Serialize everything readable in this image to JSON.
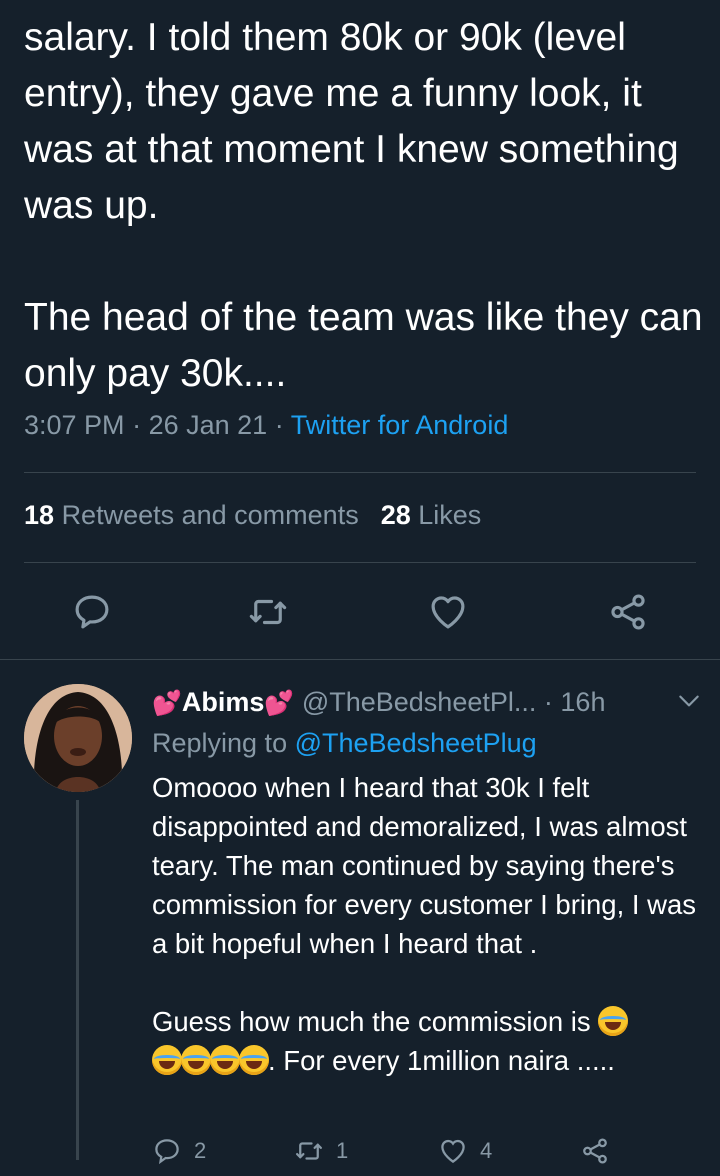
{
  "tweet": {
    "paragraph1": "salary. I told them 80k or 90k (level entry), they  gave me a funny look, it was at that moment I knew something was up.",
    "paragraph2": "The head of the team was like they can only pay 30k....",
    "time": "3:07 PM",
    "date": "26 Jan 21",
    "separator": "·",
    "source": "Twitter for Android"
  },
  "stats": {
    "retweets_count": "18",
    "retweets_label": "Retweets and comments",
    "likes_count": "28",
    "likes_label": "Likes"
  },
  "actions": {
    "icons": [
      "reply-icon",
      "retweet-icon",
      "like-icon",
      "share-icon"
    ]
  },
  "reply": {
    "display_name": "Abims",
    "name_emoji": "heart-emoji",
    "handle": "@TheBedsheetPl...",
    "separator": "·",
    "age": "16h",
    "replying_prefix": "Replying to",
    "replying_to": "@TheBedsheetPlug",
    "paragraph1": "Omoooo when I heard that 30k I felt disappointed and demoralized, I was almost teary. The man continued by saying there's commission for every customer I bring, I was a bit hopeful when I heard that .",
    "paragraph2_start": "Guess how much the commission is",
    "paragraph2_end": ". For every 1million naira .....",
    "emoji": "face-with-tears-of-joy",
    "counts": {
      "replies": "2",
      "retweets": "1",
      "likes": "4"
    }
  },
  "colors": {
    "background": "#15202b",
    "text": "#ffffff",
    "muted": "#8899a6",
    "link": "#1da1f2",
    "divider": "#38444d",
    "heart": "#e0245e"
  }
}
